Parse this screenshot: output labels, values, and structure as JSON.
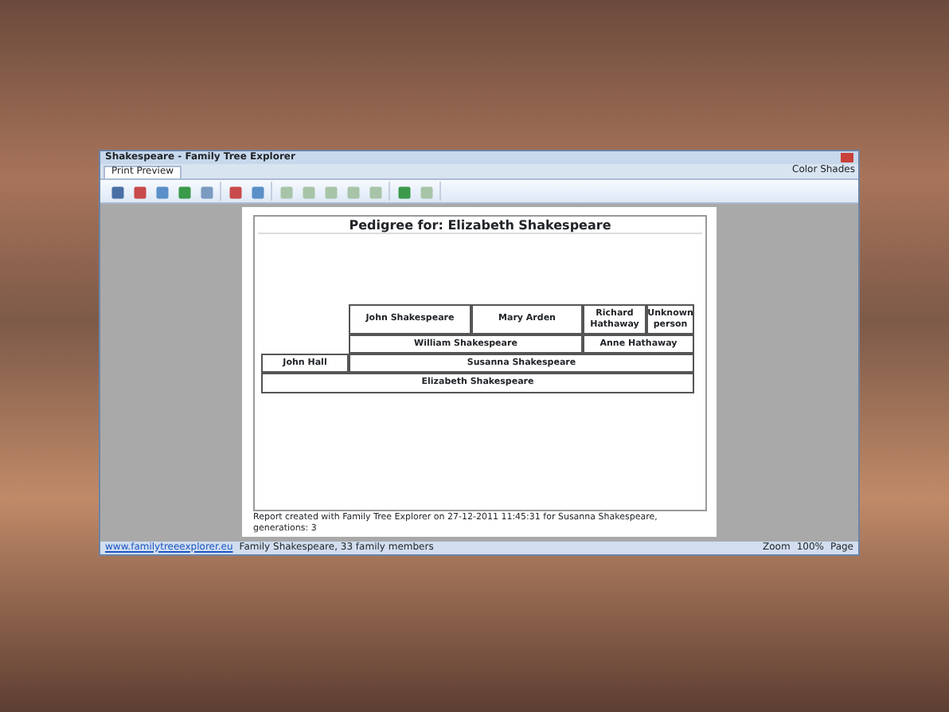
{
  "window": {
    "title": "Shakespeare - Family Tree Explorer"
  },
  "ribbon_tabs": [
    {
      "label": "Print Preview",
      "selected": true
    }
  ],
  "theme_label": "Color Shades",
  "ribbon_groups": [
    {
      "buttons": [
        {
          "disabled": false
        },
        {
          "disabled": false
        },
        {
          "disabled": false
        },
        {
          "disabled": false
        },
        {
          "disabled": false
        }
      ]
    },
    {
      "buttons": [
        {
          "disabled": false
        },
        {
          "disabled": false
        }
      ]
    },
    {
      "buttons": [
        {
          "disabled": true
        },
        {
          "disabled": true
        },
        {
          "disabled": true
        },
        {
          "disabled": true
        },
        {
          "disabled": true
        }
      ]
    },
    {
      "buttons": [
        {
          "disabled": false
        },
        {
          "disabled": true
        }
      ]
    }
  ],
  "document": {
    "title": "Pedigree for: Elizabeth Shakespeare",
    "persons": [
      {
        "name": "John Shakespeare",
        "kind": "grandparent"
      },
      {
        "name": "Mary Arden",
        "kind": "grandparent"
      },
      {
        "name": "Richard Hathaway",
        "kind": "grandparent"
      },
      {
        "name": "Unknown person",
        "kind": "grandparent"
      },
      {
        "name": "William Shakespeare",
        "kind": "parent"
      },
      {
        "name": "Anne Hathaway",
        "kind": "parent"
      },
      {
        "name": "John Hall",
        "kind": "spouse"
      },
      {
        "name": "Susanna Shakespeare",
        "kind": "spouse"
      },
      {
        "name": "Elizabeth Shakespeare",
        "kind": "root"
      }
    ],
    "footer": "Report created with Family Tree Explorer on 27-12-2011 11:45:31 for Susanna Shakespeare, generations: 3"
  },
  "status_bar": {
    "link": "www.familytreeexplorer.eu",
    "text": "Family Shakespeare, 33 family members",
    "zoom_label": "Zoom",
    "zoom_value": "100%",
    "page_label": "Page"
  }
}
